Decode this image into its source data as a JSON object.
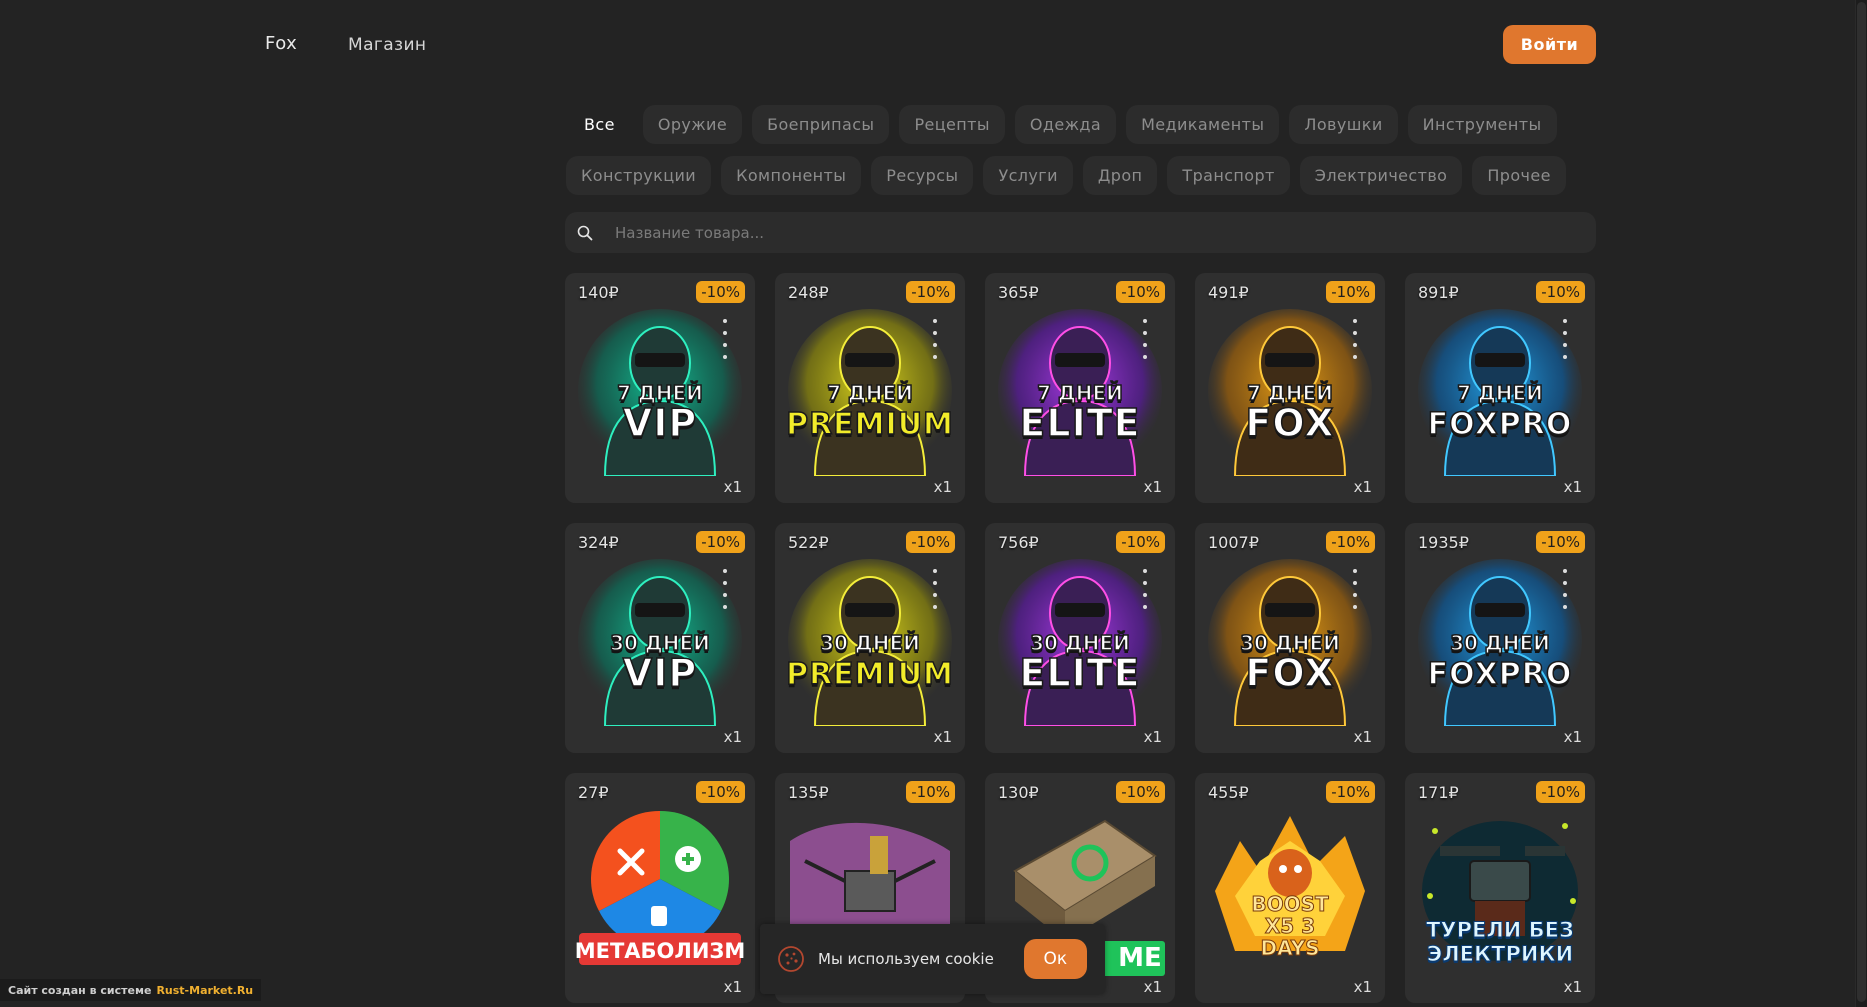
{
  "header": {
    "brand": "Fox",
    "nav_shop": "Магазин",
    "login_label": "Войти"
  },
  "categories": [
    {
      "label": "Все",
      "active": true
    },
    {
      "label": "Оружие"
    },
    {
      "label": "Боеприпасы"
    },
    {
      "label": "Рецепты"
    },
    {
      "label": "Одежда"
    },
    {
      "label": "Медикаменты"
    },
    {
      "label": "Ловушки"
    },
    {
      "label": "Инструменты"
    },
    {
      "label": "Конструкции"
    },
    {
      "label": "Компоненты"
    },
    {
      "label": "Ресурсы"
    },
    {
      "label": "Услуги"
    },
    {
      "label": "Дроп"
    },
    {
      "label": "Транспорт"
    },
    {
      "label": "Электричество"
    },
    {
      "label": "Прочее"
    }
  ],
  "search": {
    "placeholder": "Название товара..."
  },
  "products": [
    {
      "price": "140₽",
      "discount": "-10%",
      "qty": "x1",
      "days": "7 ДНЕЙ",
      "title": "VIP",
      "theme": "vip"
    },
    {
      "price": "248₽",
      "discount": "-10%",
      "qty": "x1",
      "days": "7 ДНЕЙ",
      "title": "PREMIUM",
      "theme": "premium"
    },
    {
      "price": "365₽",
      "discount": "-10%",
      "qty": "x1",
      "days": "7 ДНЕЙ",
      "title": "ELITE",
      "theme": "elite"
    },
    {
      "price": "491₽",
      "discount": "-10%",
      "qty": "x1",
      "days": "7 ДНЕЙ",
      "title": "FOX",
      "theme": "fox"
    },
    {
      "price": "891₽",
      "discount": "-10%",
      "qty": "x1",
      "days": "7 ДНЕЙ",
      "title": "FOXPRO",
      "theme": "foxpro"
    },
    {
      "price": "324₽",
      "discount": "-10%",
      "qty": "x1",
      "days": "30 ДНЕЙ",
      "title": "VIP",
      "theme": "vip"
    },
    {
      "price": "522₽",
      "discount": "-10%",
      "qty": "x1",
      "days": "30 ДНЕЙ",
      "title": "PREMIUM",
      "theme": "premium"
    },
    {
      "price": "756₽",
      "discount": "-10%",
      "qty": "x1",
      "days": "30 ДНЕЙ",
      "title": "ELITE",
      "theme": "elite"
    },
    {
      "price": "1007₽",
      "discount": "-10%",
      "qty": "x1",
      "days": "30 ДНЕЙ",
      "title": "FOX",
      "theme": "fox"
    },
    {
      "price": "1935₽",
      "discount": "-10%",
      "qty": "x1",
      "days": "30 ДНЕЙ",
      "title": "FOXPRO",
      "theme": "foxpro"
    },
    {
      "price": "27₽",
      "discount": "-10%",
      "qty": "x1",
      "days": "",
      "title": "МЕТАБОЛИЗМ",
      "theme": "metabolism"
    },
    {
      "price": "135₽",
      "discount": "-10%",
      "qty": "x1",
      "days": "",
      "title": "",
      "theme": "drone"
    },
    {
      "price": "130₽",
      "discount": "-10%",
      "qty": "x1",
      "days": "",
      "title": "ME",
      "theme": "bed"
    },
    {
      "price": "455₽",
      "discount": "-10%",
      "qty": "x1",
      "days": "",
      "title": "BOOST X5 3 DAYS",
      "theme": "boost"
    },
    {
      "price": "171₽",
      "discount": "-10%",
      "qty": "x1",
      "days": "",
      "title": "ТУРЕЛИ БЕЗ ЭЛЕКТРИКИ",
      "theme": "turret"
    }
  ],
  "footer": {
    "made_by": "Сайт создан в системе",
    "made_by_link": "Rust-Market.Ru"
  },
  "cookie": {
    "text": "Мы используем cookie",
    "ok_label": "Ок"
  },
  "colors": {
    "background": "#232323",
    "card": "#2f2f2f",
    "accent": "#e0772e",
    "discount": "#f0a21a"
  }
}
